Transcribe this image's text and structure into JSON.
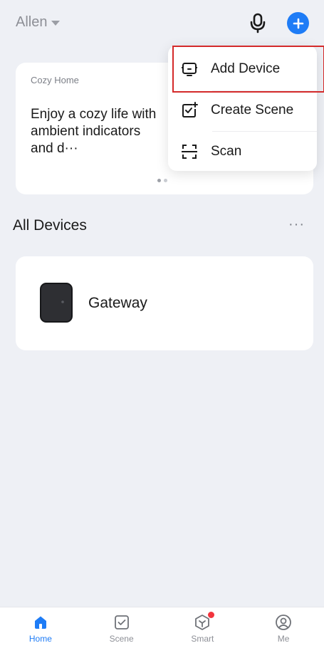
{
  "header": {
    "home_name": "Allen",
    "icons": [
      "caret-down-icon",
      "microphone-icon",
      "plus-icon"
    ],
    "accent_color": "#1e7cf6"
  },
  "banner": {
    "subtitle": "Cozy Home",
    "title": "Enjoy a cozy life with ambient indicators and d···",
    "page_count": 2,
    "active_page": 1
  },
  "devices": {
    "section_title": "All Devices",
    "more_label": "···",
    "items": [
      {
        "name": "Gateway",
        "icon": "gateway-device-image"
      }
    ]
  },
  "add_menu": {
    "items": [
      {
        "label": "Add Device",
        "icon": "add-device-icon",
        "highlighted": true
      },
      {
        "label": "Create Scene",
        "icon": "create-scene-icon"
      },
      {
        "label": "Scan",
        "icon": "scan-icon"
      }
    ],
    "highlight_color": "#d42a2a"
  },
  "tabbar": {
    "tabs": [
      {
        "label": "Home",
        "icon": "home-icon",
        "active": true
      },
      {
        "label": "Scene",
        "icon": "scene-icon"
      },
      {
        "label": "Smart",
        "icon": "smart-icon",
        "badge": true
      },
      {
        "label": "Me",
        "icon": "profile-icon"
      }
    ],
    "badge_color": "#f2343d"
  }
}
